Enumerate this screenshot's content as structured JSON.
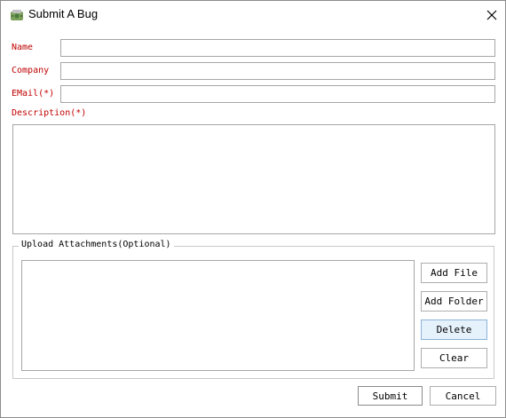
{
  "window": {
    "title": "Submit A Bug",
    "app_icon": "bug-app-icon",
    "close_icon": "close-icon"
  },
  "form": {
    "name_label": "Name",
    "name_value": "",
    "company_label": "Company",
    "company_value": "",
    "email_label": "EMail(*)",
    "email_value": "",
    "description_label": "Description(*)",
    "description_value": ""
  },
  "attachments": {
    "group_label": "Upload Attachments(Optional)",
    "files": [],
    "add_file_label": "Add File",
    "add_folder_label": "Add Folder",
    "delete_label": "Delete",
    "clear_label": "Clear"
  },
  "footer": {
    "submit_label": "Submit",
    "cancel_label": "Cancel"
  },
  "colors": {
    "required_label": "#c00000",
    "hover_button": "#e5f1fb"
  }
}
